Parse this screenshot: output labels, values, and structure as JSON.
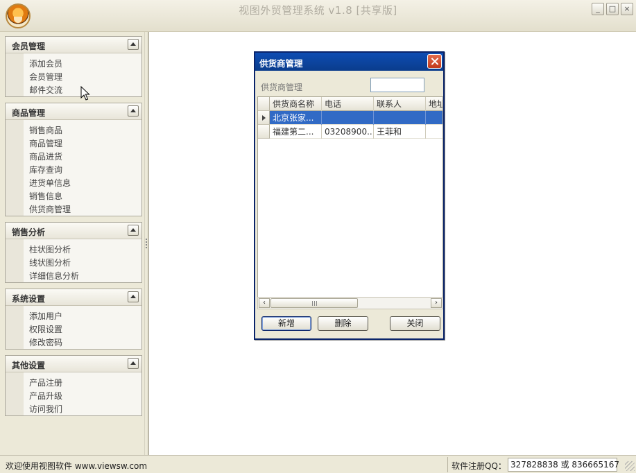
{
  "window": {
    "title": "视图外贸管理系统 v1.8 [共享版]"
  },
  "sidebar": {
    "groups": [
      {
        "title": "会员管理",
        "items": [
          "添加会员",
          "会员管理",
          "邮件交流"
        ]
      },
      {
        "title": "商品管理",
        "items": [
          "销售商品",
          "商品管理",
          "商品进货",
          "库存查询",
          "进货单信息",
          "销售信息",
          "供货商管理"
        ]
      },
      {
        "title": "销售分析",
        "items": [
          "柱状图分析",
          "线状图分析",
          "详细信息分析"
        ]
      },
      {
        "title": "系统设置",
        "items": [
          "添加用户",
          "权限设置",
          "修改密码"
        ]
      },
      {
        "title": "其他设置",
        "items": [
          "产品注册",
          "产品升级",
          "访问我们"
        ]
      }
    ]
  },
  "dialog": {
    "title": "供货商管理",
    "search_label": "供货商管理",
    "search_value": "",
    "columns": [
      "供货商名称",
      "电话",
      "联系人",
      "地址"
    ],
    "rows": [
      {
        "name": "北京张家...",
        "phone": "",
        "contact": "",
        "address": "",
        "selected": true
      },
      {
        "name": "福建第二...",
        "phone": "03208900...",
        "contact": "王菲和",
        "address": "",
        "selected": false
      }
    ],
    "buttons": {
      "add": "新增",
      "delete": "删除",
      "close": "关闭"
    }
  },
  "statusbar": {
    "welcome": "欢迎使用视图软件 www.viewsw.com",
    "qq_label": "软件注册QQ：",
    "qq_value": "327828838 或 836665167"
  },
  "colors": {
    "dialog_title": "#0a3c8c",
    "selection": "#316ac5",
    "chrome": "#ece9d8"
  }
}
